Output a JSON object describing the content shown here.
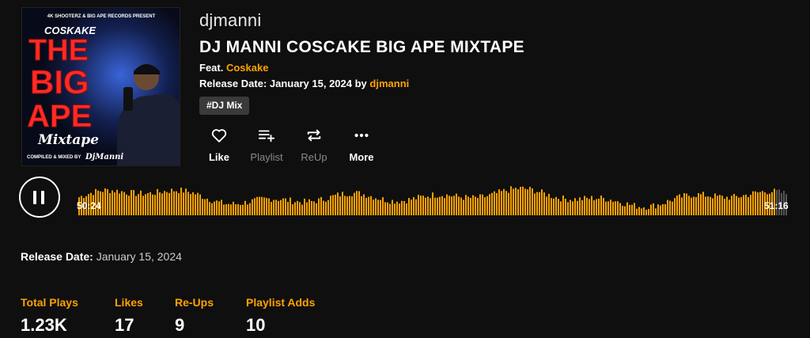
{
  "cover": {
    "presenter": "4K SHOOTERZ & BIG APE RECORDS PRESENT",
    "artist": "COSKAKE",
    "line1": "THE",
    "line2": "BIG",
    "line3": "APE",
    "script": "Mixtape",
    "credit_prefix": "COMPILED & MIXED BY",
    "credit_name": "DjManni"
  },
  "artist": "djmanni",
  "title": "DJ MANNI COSCAKE BIG APE MIXTAPE",
  "feat_label": "Feat.",
  "feat_name": "Coskake",
  "release_label": "Release Date:",
  "release_value": "January 15, 2024",
  "release_by": "by",
  "release_by_name": "djmanni",
  "tag": "#DJ Mix",
  "actions": [
    {
      "label": "Like",
      "icon": "heart-icon"
    },
    {
      "label": "Playlist",
      "icon": "playlist-add-icon"
    },
    {
      "label": "ReUp",
      "icon": "repeat-icon"
    },
    {
      "label": "More",
      "icon": "more-icon"
    }
  ],
  "player": {
    "current_time": "50:24",
    "duration": "51:16",
    "progress": 0.983,
    "state": "playing"
  },
  "details": {
    "release_label": "Release Date:",
    "release_value": "January 15, 2024"
  },
  "stats": [
    {
      "label": "Total Plays",
      "value": "1.23K"
    },
    {
      "label": "Likes",
      "value": "17"
    },
    {
      "label": "Re-Ups",
      "value": "9"
    },
    {
      "label": "Playlist Adds",
      "value": "10"
    }
  ],
  "colors": {
    "accent": "#ffa200",
    "background": "#0f0f0f",
    "wave_played": "#ffa200",
    "wave_unplayed": "#555555"
  }
}
